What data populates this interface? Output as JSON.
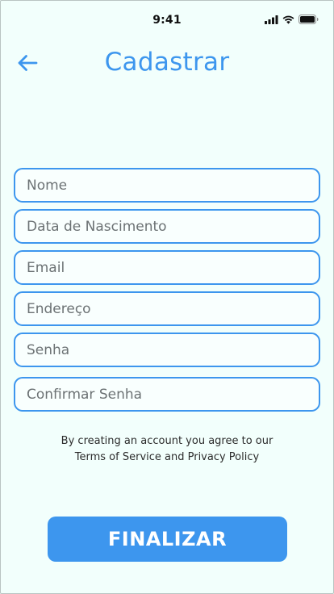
{
  "status_bar": {
    "time": "9:41",
    "icons": [
      "signal-icon",
      "wifi-icon",
      "battery-icon"
    ]
  },
  "header": {
    "back_icon": "arrow-left-icon",
    "title": "Cadastrar"
  },
  "form": {
    "name_placeholder": "Nome",
    "birthdate_placeholder": "Data de Nascimento",
    "email_placeholder": "Email",
    "address_placeholder": "Endereço",
    "password_placeholder": "Senha",
    "confirm_password_placeholder": "Confirmar Senha"
  },
  "terms": {
    "line1": "By creating an account you agree to our",
    "line2": "Terms of Service and Privacy Policy"
  },
  "actions": {
    "finalize_label": "FINALIZAR"
  },
  "colors": {
    "accent": "#3d96ee",
    "background": "#f2fffc"
  }
}
